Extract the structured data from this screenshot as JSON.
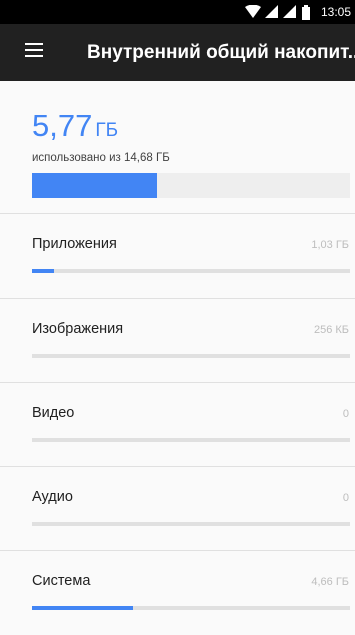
{
  "status_bar": {
    "time": "13:05",
    "icons": [
      "wifi-icon",
      "signal-icon",
      "signal-icon",
      "battery-icon"
    ]
  },
  "toolbar": {
    "menu_icon": "menu-icon",
    "title": "Внутренний общий накопит..."
  },
  "summary": {
    "used_value": "5,77",
    "used_unit": "ГБ",
    "subtitle": "использовано из 14,68 ГБ",
    "used_fraction": 0.393
  },
  "categories": [
    {
      "label": "Приложения",
      "size": "1,03 ГБ",
      "fraction": 0.07
    },
    {
      "label": "Изображения",
      "size": "256 КБ",
      "fraction": 0.0
    },
    {
      "label": "Видео",
      "size": "0",
      "fraction": 0.0
    },
    {
      "label": "Аудио",
      "size": "0",
      "fraction": 0.0
    },
    {
      "label": "Система",
      "size": "4,66 ГБ",
      "fraction": 0.317
    }
  ],
  "colors": {
    "accent": "#4285f4",
    "toolbar": "#212121",
    "status_bar": "#000000",
    "background": "#fafafa",
    "track": "#e0e0e0"
  }
}
